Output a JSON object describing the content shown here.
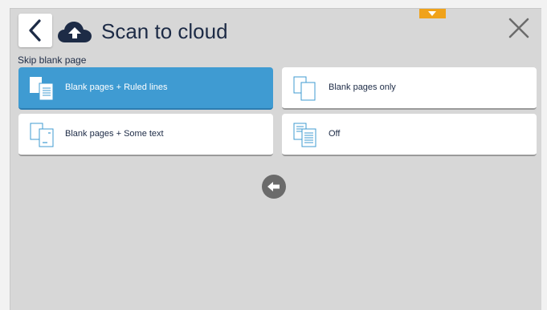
{
  "header": {
    "title": "Scan to cloud",
    "back_icon": "chevron-left-icon",
    "app_icon": "cloud-upload-icon",
    "close_icon": "close-icon",
    "dropdown_icon": "caret-down-icon"
  },
  "section": {
    "label": "Skip blank page"
  },
  "options": [
    {
      "label": "Blank pages + Ruled lines",
      "icon": "ruled-pages-icon",
      "selected": true
    },
    {
      "label": "Blank pages only",
      "icon": "blank-pages-icon",
      "selected": false
    },
    {
      "label": "Blank pages + Some text",
      "icon": "pages-some-text-icon",
      "selected": false
    },
    {
      "label": "Off",
      "icon": "text-pages-icon",
      "selected": false
    }
  ],
  "pagination": {
    "prev_icon": "arrow-left-icon"
  },
  "colors": {
    "accent": "#f0a21a",
    "selected": "#3f9bd2",
    "text": "#1d2b46",
    "background": "#d7d7d7"
  }
}
